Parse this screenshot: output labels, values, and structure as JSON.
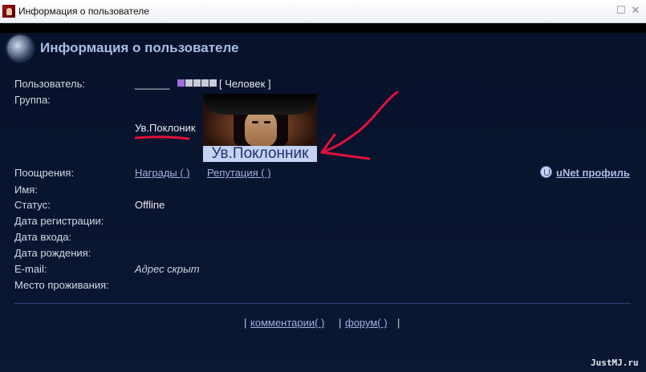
{
  "window": {
    "title": "Информация о пользователе"
  },
  "header": {
    "title": "Информация о пользователе"
  },
  "fields": {
    "user_label": "Пользователь:",
    "user_value": "______",
    "user_type": "[ Человек ]",
    "rank_squares_filled": 1,
    "rank_squares_total": 5,
    "group_label": "Группа:",
    "group_value": "Ув.Поклоник",
    "rank_image_caption": "Ув.Поклонник",
    "rewards_label": "Поощрения:",
    "awards_link": "Награды ( )",
    "reputation_link": "Репутация ( )",
    "unet_profile": "uNet профиль",
    "name_label": "Имя:",
    "status_label": "Статус:",
    "status_value": "Offline",
    "reg_date_label": "Дата регистрации:",
    "login_date_label": "Дата входа:",
    "birth_date_label": "Дата рождения:",
    "email_label": "E-mail:",
    "email_value": "Адрес скрыт",
    "location_label": "Место проживания:"
  },
  "footer": {
    "bar_left": "|",
    "comments_link": "комментарии( )",
    "bar_mid": "|",
    "forum_link": "форум( )",
    "bar_right": "|"
  },
  "watermark": "JustMJ.ru",
  "colors": {
    "accent": "#a9bce6",
    "link": "#9fb1e0",
    "annotation": "#e0103a",
    "rank_caption_bg": "#c4d3f3"
  }
}
